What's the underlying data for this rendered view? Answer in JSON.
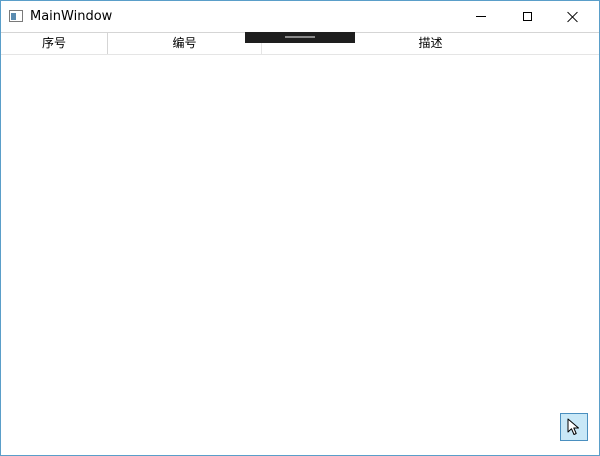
{
  "window": {
    "title": "MainWindow",
    "icon": "app-window-icon",
    "controls": {
      "minimize_icon": "minimize-icon",
      "maximize_icon": "maximize-icon",
      "close_icon": "close-icon"
    }
  },
  "grid": {
    "columns": [
      {
        "label": "序号"
      },
      {
        "label": "编号"
      },
      {
        "label": "描述"
      }
    ],
    "rows": []
  },
  "debug_toolbar": {
    "icon": "grip-handle-icon"
  },
  "selection_tool": {
    "icon": "cursor-arrow-icon"
  },
  "colors": {
    "window_border": "#5a9ec9",
    "debug_bar": "#1e1e1e",
    "selection_tool_bg": "#c9e8f7",
    "selection_tool_border": "#4a8fbf"
  }
}
